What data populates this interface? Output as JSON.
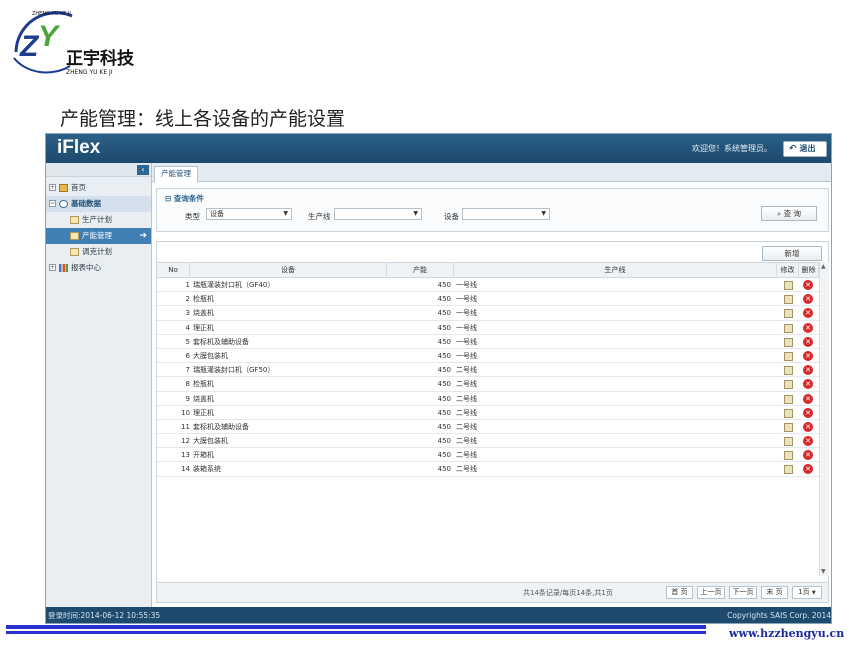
{
  "logo": {
    "initials": "ZY",
    "arc_text": "ZHENG YU KE JI",
    "company": "正宇科技",
    "pinyin": "ZHENG YU KE JI"
  },
  "slide_title": "产能管理：线上各设备的产能设置",
  "app": {
    "brand": "iFlex",
    "welcome": "欢迎您！系统管理员。",
    "logout_label": "退出",
    "sidebar": {
      "items": [
        {
          "label": "首页"
        },
        {
          "label": "基础数据"
        },
        {
          "label": "生产计划"
        },
        {
          "label": "产能管理"
        },
        {
          "label": "调克计划"
        },
        {
          "label": "报表中心"
        }
      ]
    },
    "tab_label": "产能管理",
    "query": {
      "title": "查询条件",
      "type_label": "类型",
      "type_value": "设备",
      "line_label": "生产线",
      "line_value": "",
      "device_label": "设备",
      "device_value": "",
      "search_label": "查 询"
    },
    "grid": {
      "add_label": "新增",
      "columns": [
        "No",
        "设备",
        "产能",
        "生产线",
        "修改",
        "删除"
      ],
      "rows": [
        {
          "no": "1",
          "device": "瑞瓶灌装封口机（GF40）",
          "capacity": "450",
          "line": "一号线"
        },
        {
          "no": "2",
          "device": "检瓶机",
          "capacity": "450",
          "line": "一号线"
        },
        {
          "no": "3",
          "device": "烧盖机",
          "capacity": "450",
          "line": "一号线"
        },
        {
          "no": "4",
          "device": "理正机",
          "capacity": "450",
          "line": "一号线"
        },
        {
          "no": "5",
          "device": "套标机及辅助设备",
          "capacity": "450",
          "line": "一号线"
        },
        {
          "no": "6",
          "device": "大膜包装机",
          "capacity": "450",
          "line": "一号线"
        },
        {
          "no": "7",
          "device": "瑞瓶灌装封口机（GF50）",
          "capacity": "450",
          "line": "二号线"
        },
        {
          "no": "8",
          "device": "检瓶机",
          "capacity": "450",
          "line": "二号线"
        },
        {
          "no": "9",
          "device": "烧盖机",
          "capacity": "450",
          "line": "二号线"
        },
        {
          "no": "10",
          "device": "理正机",
          "capacity": "450",
          "line": "二号线"
        },
        {
          "no": "11",
          "device": "套标机及辅助设备",
          "capacity": "450",
          "line": "二号线"
        },
        {
          "no": "12",
          "device": "大膜包装机",
          "capacity": "450",
          "line": "二号线"
        },
        {
          "no": "13",
          "device": "开箱机",
          "capacity": "450",
          "line": "二号线"
        },
        {
          "no": "14",
          "device": "装箱系统",
          "capacity": "450",
          "line": "二号线"
        }
      ]
    },
    "pager": {
      "info": "共14条记录/每页14条,共1页",
      "first": "首 页",
      "prev": "上一页",
      "next": "下一页",
      "last": "末 页",
      "page_select": "1页"
    },
    "status": {
      "login_time": "登录时间:2014-06-12 10:55:35",
      "copyright": "Copyrights SAIS Corp. 2014"
    }
  },
  "website": "www.hzzhengyu.cn",
  "colors": {
    "header": "#1d4a6d",
    "accent": "#3f7fb3",
    "delete": "#d8292b",
    "banner": "#2a2fcf"
  }
}
